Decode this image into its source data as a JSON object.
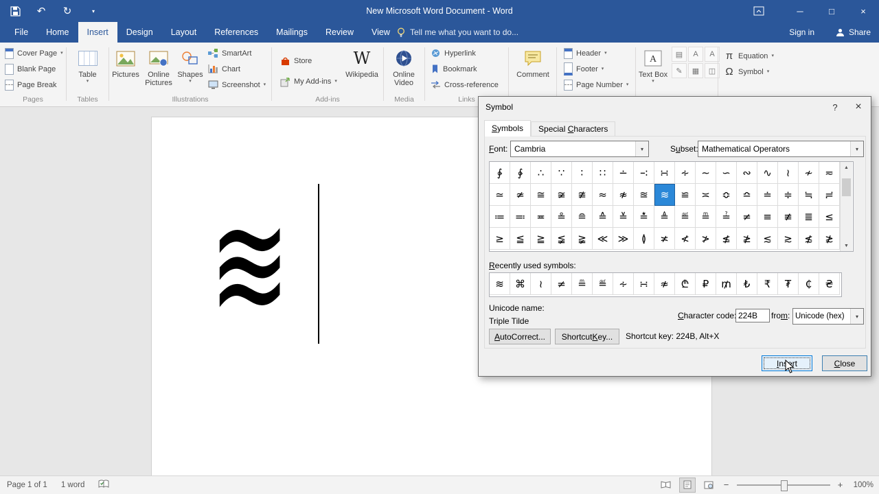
{
  "titlebar": {
    "title": "New Microsoft Word Document - Word"
  },
  "icons": {
    "dropdown": "▾",
    "undo": "↶",
    "redo": "↻",
    "minimize": "─",
    "maximize": "□",
    "close": "×",
    "help": "?",
    "scroll_up": "▲",
    "scroll_down": "▼",
    "wikipedia_w": "W",
    "equation_pi": "π",
    "symbol_omega": "Ω",
    "quick_parts": "▤",
    "wordart": "A",
    "drop_cap": "A",
    "signature_line": "✎",
    "date_time": "▦",
    "object": "◫"
  },
  "ribbon": {
    "tabs": [
      "File",
      "Home",
      "Insert",
      "Design",
      "Layout",
      "References",
      "Mailings",
      "Review",
      "View"
    ],
    "active_tab": "Insert",
    "tell_me": "Tell me what you want to do...",
    "sign_in": "Sign in",
    "share": "Share",
    "groups": {
      "pages": {
        "label": "Pages",
        "cover_page": "Cover Page",
        "blank_page": "Blank Page",
        "page_break": "Page Break"
      },
      "tables": {
        "label": "Tables",
        "table": "Table"
      },
      "illustrations": {
        "label": "Illustrations",
        "pictures": "Pictures",
        "online_pictures": "Online Pictures",
        "shapes": "Shapes",
        "smartart": "SmartArt",
        "chart": "Chart",
        "screenshot": "Screenshot"
      },
      "addins": {
        "label": "Add-ins",
        "store": "Store",
        "my_addins": "My Add-ins",
        "wikipedia": "Wikipedia"
      },
      "media": {
        "label": "Media",
        "online_video": "Online Video"
      },
      "links": {
        "label": "Links",
        "hyperlink": "Hyperlink",
        "bookmark": "Bookmark",
        "cross_reference": "Cross-reference"
      },
      "comments": {
        "comment": "Comment"
      },
      "header_footer": {
        "header": "Header",
        "footer": "Footer",
        "page_number": "Page Number"
      },
      "text": {
        "text_box": "Text Box"
      },
      "symbols": {
        "equation": "Equation",
        "symbol": "Symbol"
      }
    }
  },
  "document": {
    "inserted_symbol": "≋"
  },
  "dialog": {
    "title": "Symbol",
    "tab_symbols": "Symbols",
    "tab_special": "Special Characters",
    "font_label": "Font:",
    "font_value": "Cambria",
    "subset_label": "Subset:",
    "subset_value": "Mathematical Operators",
    "grid": {
      "rows": [
        [
          "∲",
          "∳",
          "∴",
          "∵",
          "∶",
          "∷",
          "∸",
          "∹",
          "∺",
          "∻",
          "∼",
          "∽",
          "∾",
          "∿",
          "≀",
          "≁",
          "≂"
        ],
        [
          "≃",
          "≄",
          "≅",
          "≆",
          "≇",
          "≈",
          "≉",
          "≊",
          "≋",
          "≌",
          "≍",
          "≎",
          "≏",
          "≐",
          "≑",
          "≒",
          "≓"
        ],
        [
          "≔",
          "≕",
          "≖",
          "≗",
          "≘",
          "≙",
          "≚",
          "≛",
          "≜",
          "≝",
          "≞",
          "≟",
          "≠",
          "≡",
          "≢",
          "≣",
          "≤"
        ],
        [
          "≥",
          "≦",
          "≧",
          "≨",
          "≩",
          "≪",
          "≫",
          "≬",
          "≭",
          "≮",
          "≯",
          "≰",
          "≱",
          "≲",
          "≳",
          "≴",
          "≵"
        ]
      ],
      "selected_row": 1,
      "selected_col": 8
    },
    "recently_label": "Recently used symbols:",
    "recently_used": [
      "≋",
      "⌘",
      "≀",
      "≠",
      "≞",
      "≝",
      "∻",
      "∺",
      "≉",
      "₾",
      "₽",
      "₥",
      "₺",
      "₹",
      "₮",
      "₵",
      "₴"
    ],
    "unicode_name_label": "Unicode name:",
    "unicode_name": "Triple Tilde",
    "char_code_label": "Character code:",
    "char_code": "224B",
    "from_label": "from:",
    "from_value": "Unicode (hex)",
    "autocorrect_btn": "AutoCorrect...",
    "shortcut_btn": "Shortcut Key...",
    "shortcut_text": "Shortcut key: 224B, Alt+X",
    "insert_btn": "Insert",
    "close_btn": "Close"
  },
  "statusbar": {
    "page": "Page 1 of 1",
    "words": "1 word",
    "zoom": "100%",
    "zoom_out": "−",
    "zoom_in": "+"
  }
}
